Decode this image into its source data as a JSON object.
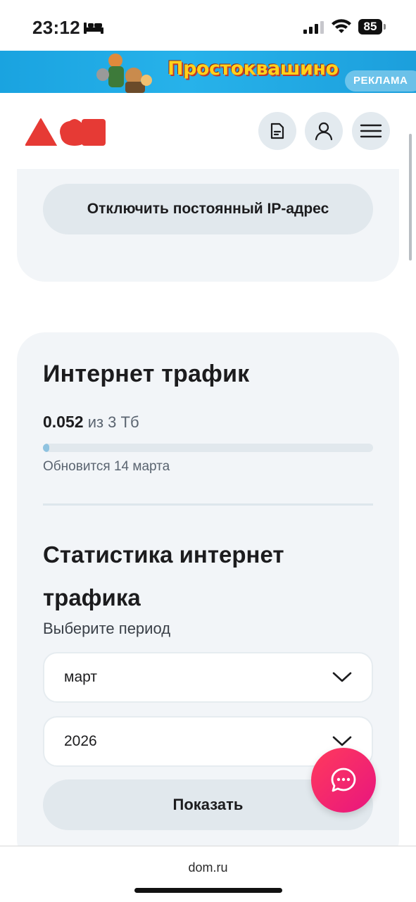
{
  "status_bar": {
    "time": "23:12",
    "battery": "85",
    "icons": [
      "bed-icon",
      "signal-icon",
      "wifi-icon",
      "battery-icon"
    ]
  },
  "ad": {
    "logo_text": "Простоквашино",
    "badge": "РЕКЛАМА"
  },
  "header": {
    "icons": [
      "document-icon",
      "user-icon",
      "menu-icon"
    ]
  },
  "ip_card": {
    "button_label": "Отключить постоянный IP-адрес"
  },
  "traffic": {
    "title": "Интернет трафик",
    "used": "0.052",
    "of_total": "из 3 Тб",
    "progress_fraction": 0.017,
    "refresh_note": "Обновится 14 марта"
  },
  "stats": {
    "title": "Статистика интернет трафика",
    "period_label": "Выберите период",
    "month_value": "март",
    "year_value": "2026",
    "show_button": "Показать"
  },
  "browser": {
    "url": "dom.ru"
  },
  "colors": {
    "accent_red": "#e63a35",
    "fab_gradient_start": "#ff3a5c",
    "fab_gradient_end": "#e8157f",
    "card_bg": "#f2f5f8",
    "progress_fill": "#8fc3e0"
  }
}
